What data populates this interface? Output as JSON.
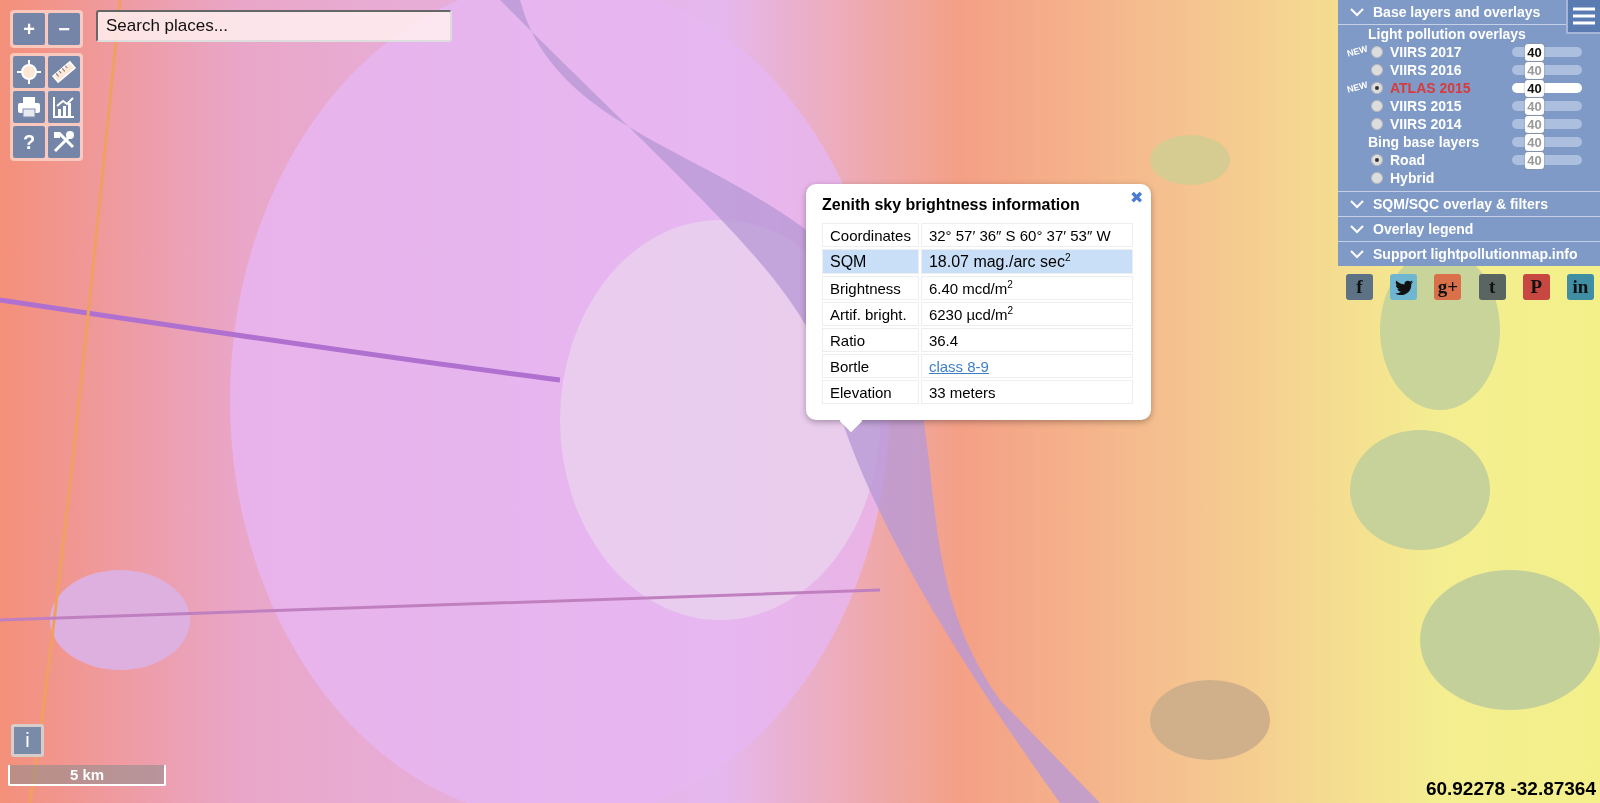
{
  "zoom_controls": [
    {
      "label": "+"
    },
    {
      "label": "−"
    }
  ],
  "tools": [
    {
      "kind": "locate"
    },
    {
      "kind": "ruler"
    },
    {
      "kind": "print"
    },
    {
      "kind": "chart"
    },
    {
      "kind": "text",
      "label": "?"
    },
    {
      "kind": "tools"
    }
  ],
  "search": {
    "placeholder": "Search places..."
  },
  "popup": {
    "title": "Zenith sky brightness information",
    "close": "✖",
    "rows": [
      {
        "label": "Coordinates",
        "value": "32° 57′ 36″ S 60° 37′ 53″ W",
        "selected": false
      },
      {
        "label": "SQM",
        "value": "18.07 mag./arc sec$^{2}$",
        "selected": true
      },
      {
        "label": "Brightness",
        "value": "6.40 mcd/m$^{2}$",
        "selected": false
      },
      {
        "label": "Artif. bright.",
        "value": "6230 µcd/m$^{2}$",
        "selected": false
      },
      {
        "label": "Ratio",
        "value": "36.4",
        "selected": false
      },
      {
        "label": "Bortle",
        "value": "class 8-9",
        "kind": "link",
        "selected": false
      },
      {
        "label": "Elevation",
        "value": "33 meters",
        "selected": false
      }
    ]
  },
  "layers_panel": {
    "sections": [
      {
        "title": "Base layers and overlays",
        "overlays_title": "Light pollution overlays",
        "overlays": [
          {
            "label": "VIIRS 2017",
            "badge": "NEW",
            "selected": false,
            "slider": {
              "value": "40",
              "level": 0.3,
              "enabled": true
            }
          },
          {
            "label": "VIIRS 2016",
            "selected": false,
            "slider": {
              "value": "40",
              "level": 0.3,
              "enabled": false
            }
          },
          {
            "label": "ATLAS 2015",
            "badge": "NEW",
            "selected": true,
            "slider": {
              "value": "40",
              "level": 0.3,
              "enabled": true
            }
          },
          {
            "label": "VIIRS 2015",
            "selected": false,
            "slider": {
              "value": "40",
              "level": 0.3,
              "enabled": false
            }
          },
          {
            "label": "VIIRS 2014",
            "selected": false,
            "slider": {
              "value": "40",
              "level": 0.3,
              "enabled": false
            }
          }
        ],
        "base_title": "Bing base layers",
        "base_slider": {
          "value": "40",
          "level": 0.3,
          "enabled": false
        },
        "base_layers": [
          {
            "label": "Road",
            "selected": true,
            "slider": {
              "value": "40",
              "level": 0.3,
              "enabled": false
            }
          },
          {
            "label": "Hybrid",
            "selected": false
          }
        ]
      },
      {
        "title": "SQM/SQC overlay & filters"
      },
      {
        "title": "Overlay legend"
      },
      {
        "title": "Support lightpollutionmap.info"
      }
    ]
  },
  "social": [
    {
      "label": "f",
      "color": "#5d7285"
    },
    {
      "kind": "bird",
      "color": "#6fb7d1"
    },
    {
      "label": "g+",
      "color": "#d9704a"
    },
    {
      "label": "t",
      "color": "#5a6561"
    },
    {
      "label": "P",
      "color": "#c64840"
    },
    {
      "label": "in",
      "color": "#3f8ea3"
    }
  ],
  "info_button": "i",
  "scale": "5 km",
  "cursor_coordinates": "60.92278 -32.87364"
}
